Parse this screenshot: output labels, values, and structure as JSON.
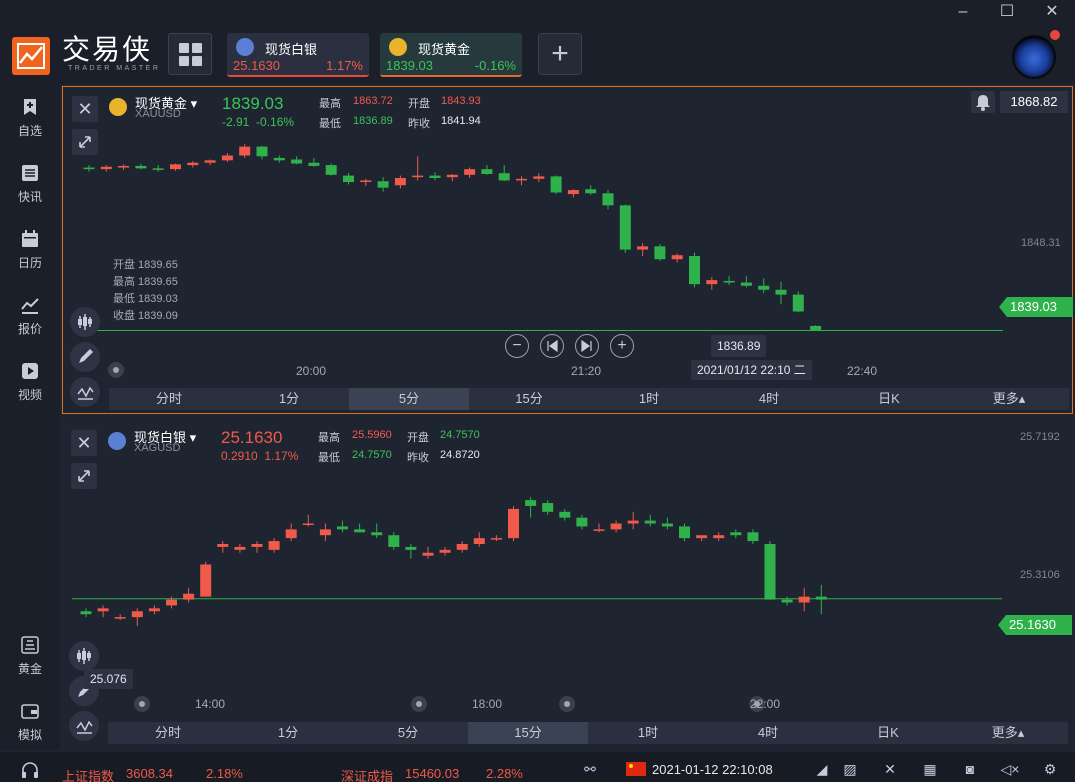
{
  "app": {
    "brand": "交易侠",
    "brand_sub": "TRADER MASTER"
  },
  "tabs": [
    {
      "name": "现货白银",
      "price": "25.1630",
      "change": "1.17%",
      "color": "#f05a4a"
    },
    {
      "name": "现货黄金",
      "price": "1839.03",
      "change": "-0.16%",
      "color": "#3cc35a"
    }
  ],
  "add_symbol_label": "+",
  "nav": [
    "自选",
    "快讯",
    "日历",
    "报价",
    "视频",
    "黄金",
    "模拟"
  ],
  "colors": {
    "up": "#f05a4a",
    "down": "#2fb24b",
    "accent": "#e5701e"
  },
  "gold_panel": {
    "name": "现货黄金",
    "code": "XAUUSD",
    "price": "1839.03",
    "change": "-2.91",
    "change_pct": "-0.16%",
    "high_label": "最高",
    "high": "1863.72",
    "low_label": "最低",
    "low": "1836.89",
    "open_label": "开盘",
    "open": "1843.93",
    "prev_label": "昨收",
    "prev": "1841.94",
    "chart_high": "1868.82",
    "ohlc": [
      "开盘 1839.65",
      "最高 1839.65",
      "最低 1839.03",
      "收盘 1839.09"
    ],
    "y_labels": [
      "1848.31"
    ],
    "x_labels": [
      "20:00",
      "21:20",
      "22:40"
    ],
    "current_tag": "1839.03",
    "low_tooltip": "1836.89",
    "crosshair_time": "2021/01/12 22:10 二",
    "timeframes": [
      "分时",
      "1分",
      "5分",
      "15分",
      "1时",
      "4时",
      "日K",
      "更多▴"
    ],
    "active_tf": 2
  },
  "silver_panel": {
    "name": "现货白银",
    "code": "XAGUSD",
    "price": "25.1630",
    "change": "0.2910",
    "change_pct": "1.17%",
    "high_label": "最高",
    "high": "25.5960",
    "low_label": "最低",
    "low": "24.7570",
    "open_label": "开盘",
    "open": "24.7570",
    "prev_label": "昨收",
    "prev": "24.8720",
    "y_labels": [
      "25.7192",
      "25.3106"
    ],
    "x_labels": [
      "14:00",
      "18:00",
      "22:00"
    ],
    "current_tag": "25.1630",
    "low_tooltip": "25.076",
    "timeframes": [
      "分时",
      "1分",
      "5分",
      "15分",
      "1时",
      "4时",
      "日K",
      "更多▴"
    ],
    "active_tf": 3
  },
  "chart_data": [
    {
      "type": "candlestick",
      "symbol": "XAUUSD",
      "interval": "5分",
      "x_ticks": [
        "20:00",
        "21:20",
        "22:40"
      ],
      "y_ticks": [
        "1848.31"
      ],
      "last": 1839.03,
      "low_marker": 1836.89,
      "ylim": [
        1834.0,
        1868.82
      ],
      "ohlc": [
        [
          1859.3,
          1859.6,
          1858.8,
          1859.1
        ],
        [
          1859.1,
          1859.6,
          1858.8,
          1859.4
        ],
        [
          1859.3,
          1859.7,
          1859.0,
          1859.5
        ],
        [
          1859.5,
          1859.8,
          1859.1,
          1859.2
        ],
        [
          1859.2,
          1859.6,
          1858.8,
          1859.1
        ],
        [
          1859.1,
          1859.8,
          1858.9,
          1859.7
        ],
        [
          1859.6,
          1860.1,
          1859.3,
          1859.9
        ],
        [
          1859.9,
          1860.3,
          1859.6,
          1860.2
        ],
        [
          1860.2,
          1861.1,
          1860.0,
          1860.8
        ],
        [
          1860.8,
          1862.2,
          1860.5,
          1861.9
        ],
        [
          1861.9,
          1862.0,
          1860.3,
          1860.7
        ],
        [
          1860.5,
          1860.8,
          1859.9,
          1860.2
        ],
        [
          1860.3,
          1860.7,
          1859.7,
          1859.8
        ],
        [
          1859.9,
          1860.5,
          1859.4,
          1859.5
        ],
        [
          1859.6,
          1859.8,
          1858.3,
          1858.4
        ],
        [
          1858.3,
          1858.6,
          1857.2,
          1857.5
        ],
        [
          1857.5,
          1857.9,
          1857.0,
          1857.7
        ],
        [
          1857.6,
          1858.1,
          1856.3,
          1856.8
        ],
        [
          1857.1,
          1858.3,
          1856.7,
          1858.0
        ],
        [
          1858.1,
          1860.7,
          1857.7,
          1858.3
        ],
        [
          1858.3,
          1858.7,
          1857.7,
          1858.0
        ],
        [
          1858.1,
          1858.5,
          1857.6,
          1858.4
        ],
        [
          1858.4,
          1859.3,
          1858.0,
          1859.1
        ],
        [
          1859.1,
          1859.6,
          1858.4,
          1858.5
        ],
        [
          1858.6,
          1859.6,
          1857.6,
          1857.7
        ],
        [
          1857.7,
          1858.2,
          1857.1,
          1857.9
        ],
        [
          1857.9,
          1858.6,
          1857.5,
          1858.2
        ],
        [
          1858.2,
          1858.3,
          1856.0,
          1856.2
        ],
        [
          1856.0,
          1856.6,
          1855.6,
          1856.5
        ],
        [
          1856.6,
          1857.1,
          1855.9,
          1856.1
        ],
        [
          1856.1,
          1856.5,
          1854.1,
          1854.6
        ],
        [
          1854.6,
          1854.7,
          1848.7,
          1849.1
        ],
        [
          1849.1,
          1849.9,
          1848.3,
          1849.5
        ],
        [
          1849.5,
          1849.8,
          1847.7,
          1847.9
        ],
        [
          1847.9,
          1848.6,
          1847.5,
          1848.4
        ],
        [
          1848.3,
          1848.7,
          1844.4,
          1844.8
        ],
        [
          1844.8,
          1845.7,
          1844.1,
          1845.3
        ],
        [
          1845.2,
          1845.8,
          1844.7,
          1845.0
        ],
        [
          1845.0,
          1845.8,
          1844.4,
          1844.6
        ],
        [
          1844.6,
          1845.5,
          1843.7,
          1844.1
        ],
        [
          1844.1,
          1845.1,
          1842.3,
          1843.5
        ],
        [
          1843.5,
          1843.9,
          1841.3,
          1841.4
        ],
        [
          1839.6,
          1839.7,
          1839.0,
          1839.1
        ]
      ]
    },
    {
      "type": "candlestick",
      "symbol": "XAGUSD",
      "interval": "15分",
      "x_ticks": [
        "14:00",
        "18:00",
        "22:00"
      ],
      "y_ticks": [
        "25.7192",
        "25.3106"
      ],
      "last": 25.163,
      "low_marker": 25.076,
      "ylim": [
        24.95,
        25.7192
      ],
      "ohlc": [
        [
          25.12,
          25.13,
          25.1,
          25.11
        ],
        [
          25.12,
          25.14,
          25.1,
          25.13
        ],
        [
          25.1,
          25.11,
          25.09,
          25.1
        ],
        [
          25.1,
          25.13,
          25.07,
          25.12
        ],
        [
          25.12,
          25.14,
          25.11,
          25.13
        ],
        [
          25.14,
          25.17,
          25.13,
          25.16
        ],
        [
          25.16,
          25.2,
          25.15,
          25.18
        ],
        [
          25.17,
          25.29,
          25.17,
          25.28
        ],
        [
          25.34,
          25.36,
          25.32,
          25.35
        ],
        [
          25.33,
          25.35,
          25.32,
          25.34
        ],
        [
          25.34,
          25.36,
          25.32,
          25.35
        ],
        [
          25.33,
          25.37,
          25.32,
          25.36
        ],
        [
          25.37,
          25.42,
          25.36,
          25.4
        ],
        [
          25.42,
          25.45,
          25.41,
          25.42
        ],
        [
          25.38,
          25.42,
          25.36,
          25.4
        ],
        [
          25.41,
          25.43,
          25.39,
          25.4
        ],
        [
          25.4,
          25.42,
          25.39,
          25.39
        ],
        [
          25.39,
          25.42,
          25.37,
          25.38
        ],
        [
          25.38,
          25.39,
          25.33,
          25.34
        ],
        [
          25.34,
          25.35,
          25.3,
          25.33
        ],
        [
          25.31,
          25.34,
          25.3,
          25.32
        ],
        [
          25.32,
          25.34,
          25.31,
          25.33
        ],
        [
          25.33,
          25.36,
          25.32,
          25.35
        ],
        [
          25.35,
          25.39,
          25.34,
          25.37
        ],
        [
          25.37,
          25.38,
          25.36,
          25.37
        ],
        [
          25.37,
          25.48,
          25.36,
          25.47
        ],
        [
          25.5,
          25.51,
          25.44,
          25.48
        ],
        [
          25.49,
          25.5,
          25.45,
          25.46
        ],
        [
          25.46,
          25.47,
          25.43,
          25.44
        ],
        [
          25.44,
          25.45,
          25.4,
          25.41
        ],
        [
          25.4,
          25.42,
          25.39,
          25.4
        ],
        [
          25.4,
          25.43,
          25.39,
          25.42
        ],
        [
          25.42,
          25.46,
          25.4,
          25.43
        ],
        [
          25.43,
          25.45,
          25.41,
          25.42
        ],
        [
          25.42,
          25.44,
          25.4,
          25.41
        ],
        [
          25.41,
          25.42,
          25.36,
          25.37
        ],
        [
          25.37,
          25.38,
          25.36,
          25.38
        ],
        [
          25.37,
          25.39,
          25.36,
          25.38
        ],
        [
          25.39,
          25.4,
          25.37,
          25.38
        ],
        [
          25.39,
          25.4,
          25.35,
          25.36
        ],
        [
          25.35,
          25.36,
          25.16,
          25.16
        ],
        [
          25.16,
          25.17,
          25.14,
          25.15
        ],
        [
          25.15,
          25.2,
          25.12,
          25.17
        ],
        [
          25.17,
          25.21,
          25.11,
          25.16
        ]
      ]
    }
  ],
  "status": {
    "sh_label": "上证指数",
    "sh_value": "3608.34",
    "sh_change": "2.18%",
    "sz_label": "深证成指",
    "sz_value": "15460.03",
    "sz_change": "2.28%",
    "datetime": "2021-01-12 22:10:08"
  },
  "icons": [
    "minimize-icon",
    "maximize-icon",
    "close-icon",
    "headset-icon",
    "flag-cn-icon",
    "signal-icon",
    "tools-icon",
    "calendar-icon",
    "camera-icon",
    "mute-icon",
    "settings-icon"
  ]
}
